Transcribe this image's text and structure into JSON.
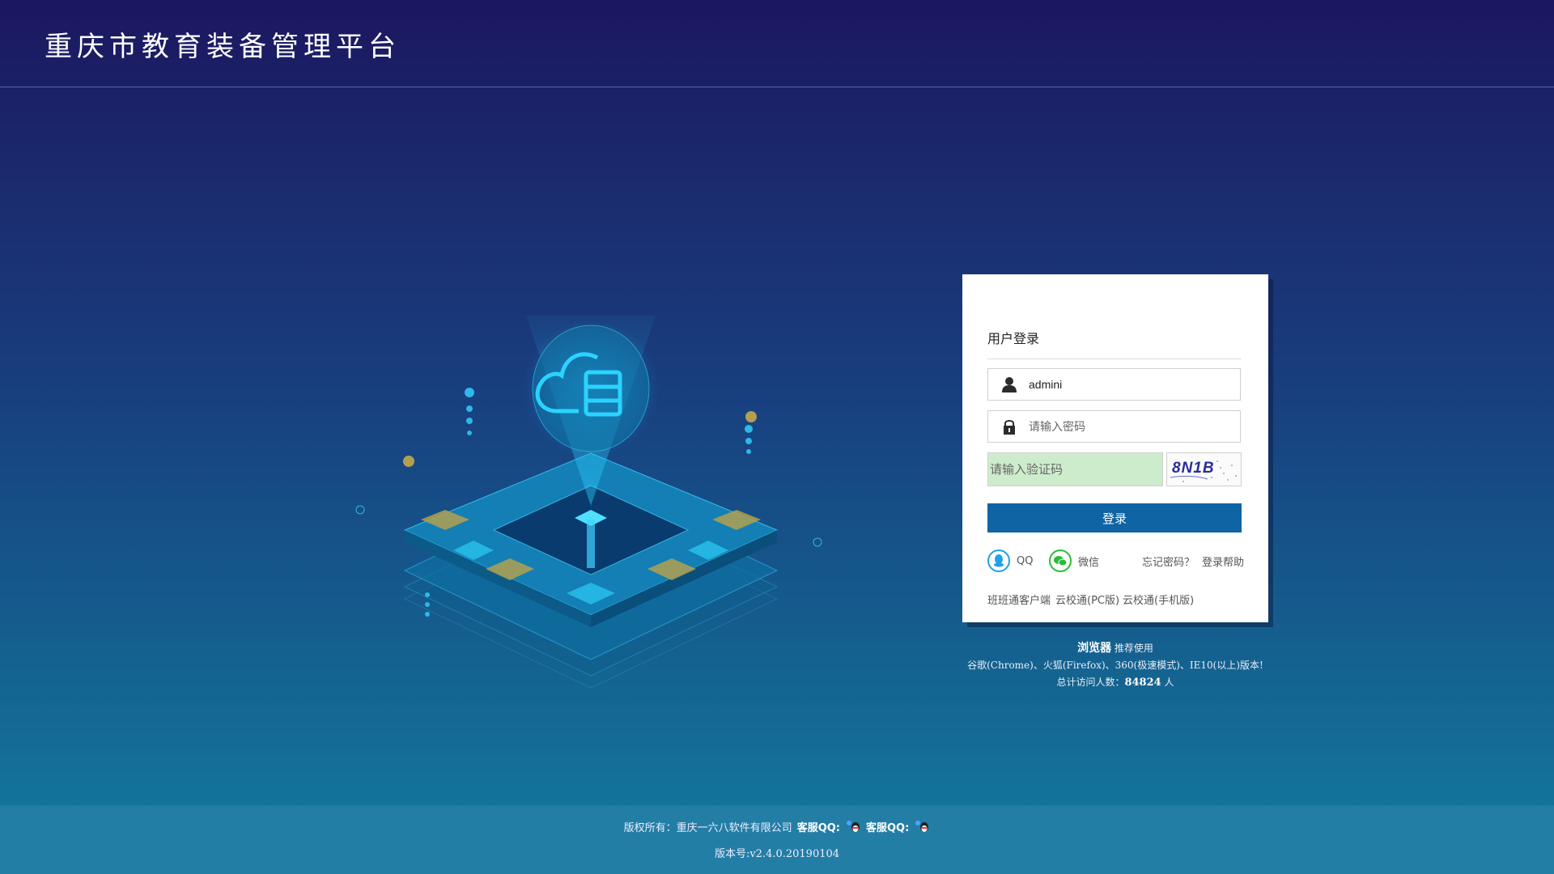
{
  "header": {
    "title": "重庆市教育装备管理平台"
  },
  "login": {
    "title": "用户登录",
    "username_value": "admini",
    "password_placeholder": "请输入密码",
    "captcha_placeholder": "请输入验证码",
    "captcha_code": "8N1B",
    "submit_label": "登录",
    "qq_label": "QQ",
    "wechat_label": "微信",
    "forgot_label": "忘记密码？",
    "help_label": "登录帮助",
    "links": [
      "班班通客户端",
      "云校通(PC版)",
      "云校通(手机版)"
    ]
  },
  "info": {
    "browser_label": "浏览器",
    "browser_suffix": "推荐使用",
    "browsers": "谷歌(Chrome)、火狐(Firefox)、360(极速模式)、IE10(以上)版本!",
    "visits_label": "总计访问人数：",
    "visits_count": "84824",
    "visits_unit": "人"
  },
  "footer": {
    "copyright": "版权所有：重庆一六八软件有限公司",
    "service_qq_1": "客服QQ:",
    "service_qq_2": "客服QQ:",
    "version": "版本号:v2.4.0.20190104"
  },
  "colors": {
    "primary": "#0f64a4",
    "captcha_bg": "#cdeccb",
    "qq_blue": "#1ea2e8",
    "wechat_green": "#2dbb3a"
  },
  "icons": [
    "user-icon",
    "lock-icon",
    "qq-icon",
    "wechat-icon",
    "cloud-server-icon"
  ]
}
